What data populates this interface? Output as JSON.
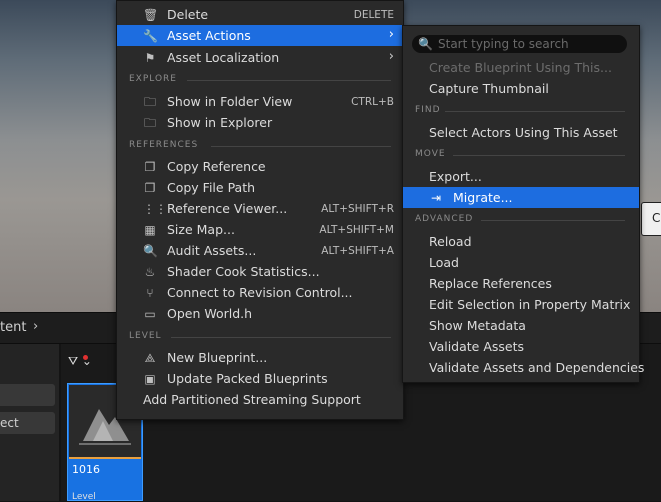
{
  "background": {
    "content_label": "tent",
    "left_buttons": [
      "",
      "ect"
    ],
    "asset": {
      "name": "1016",
      "type": "Level"
    },
    "tooltip_text": "C"
  },
  "main_menu": {
    "items": [
      {
        "label": "Delete",
        "shortcut": "DELETE",
        "icon": "trash-icon"
      },
      {
        "label": "Asset Actions",
        "icon": "wrench-icon",
        "has_submenu": true,
        "highlighted": true
      },
      {
        "label": "Asset Localization",
        "icon": "flag-icon",
        "has_submenu": true
      }
    ],
    "explore_header": "EXPLORE",
    "explore": [
      {
        "label": "Show in Folder View",
        "shortcut": "CTRL+B",
        "icon": "folder-search-icon"
      },
      {
        "label": "Show in Explorer",
        "icon": "folder-search-icon"
      }
    ],
    "references_header": "REFERENCES",
    "references": [
      {
        "label": "Copy Reference",
        "icon": "copy-icon"
      },
      {
        "label": "Copy File Path",
        "icon": "copy-icon"
      },
      {
        "label": "Reference Viewer...",
        "shortcut": "ALT+SHIFT+R",
        "icon": "reference-viewer-icon"
      },
      {
        "label": "Size Map...",
        "shortcut": "ALT+SHIFT+M",
        "icon": "size-map-icon"
      },
      {
        "label": "Audit Assets...",
        "shortcut": "ALT+SHIFT+A",
        "icon": "audit-icon"
      },
      {
        "label": "Shader Cook Statistics...",
        "icon": "shader-icon"
      },
      {
        "label": "Connect to Revision Control...",
        "icon": "revision-control-icon"
      },
      {
        "label": "Open World.h",
        "icon": "cpp-file-icon"
      }
    ],
    "level_header": "LEVEL",
    "level": [
      {
        "label": "New Blueprint...",
        "icon": "blueprint-icon"
      },
      {
        "label": "Update Packed Blueprints",
        "icon": "packed-blueprint-icon"
      },
      {
        "label": "Add Partitioned Streaming Support"
      }
    ]
  },
  "sub_menu": {
    "search_placeholder": "Start typing to search",
    "items_top": [
      {
        "label": "Create Blueprint Using This...",
        "disabled": true
      },
      {
        "label": "Capture Thumbnail"
      }
    ],
    "find_header": "FIND",
    "find": [
      {
        "label": "Select Actors Using This Asset"
      }
    ],
    "move_header": "MOVE",
    "move": [
      {
        "label": "Export..."
      },
      {
        "label": "Migrate...",
        "highlighted": true,
        "icon": "migrate-icon"
      }
    ],
    "advanced_header": "ADVANCED",
    "advanced": [
      {
        "label": "Reload"
      },
      {
        "label": "Load"
      },
      {
        "label": "Replace References"
      },
      {
        "label": "Edit Selection in Property Matrix"
      },
      {
        "label": "Show Metadata"
      },
      {
        "label": "Validate Assets"
      },
      {
        "label": "Validate Assets and Dependencies"
      }
    ]
  },
  "colors": {
    "highlight": "#1d6de0",
    "menu_bg": "#2a2a2a",
    "section": "#8a8a8a"
  }
}
